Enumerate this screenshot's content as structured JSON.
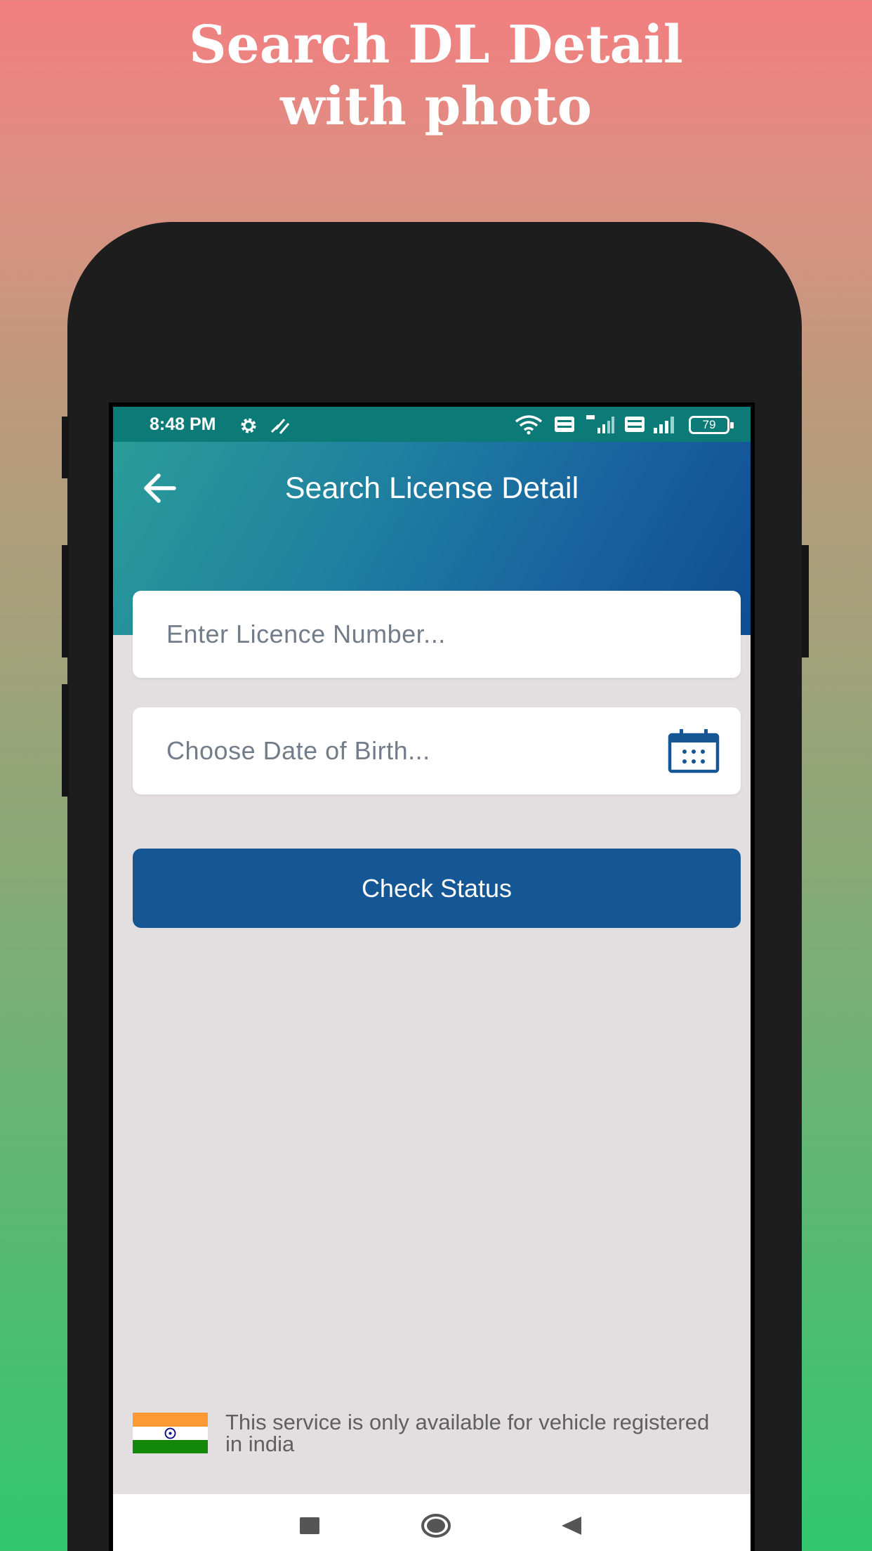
{
  "promo": {
    "title_line1": "Search DL Detail",
    "title_line2": "with photo"
  },
  "status_bar": {
    "time": "8:48 PM",
    "battery": "79",
    "icons": [
      "gear-icon",
      "satellite-icon",
      "wifi-icon",
      "volte-icon",
      "signal-4g-icon",
      "volte-icon",
      "signal-icon",
      "battery-icon"
    ]
  },
  "header": {
    "title": "Search License Detail",
    "back_icon": "arrow-left-icon"
  },
  "form": {
    "licence_placeholder": "Enter Licence Number...",
    "dob_placeholder": "Choose Date of Birth...",
    "calendar_icon": "calendar-icon",
    "check_button_label": "Check Status"
  },
  "footer": {
    "note": "This service is only available for vehicle registered in india",
    "flag_icon": "india-flag-icon"
  },
  "nav_bar": {
    "items": [
      "recents-square-icon",
      "home-circle-icon",
      "back-triangle-icon"
    ]
  },
  "colors": {
    "header_start": "#2a9d98",
    "header_end": "#0f4d91",
    "button": "#155795",
    "screen_bg": "#e3dfe0",
    "status_bar": "#0c7a76"
  }
}
